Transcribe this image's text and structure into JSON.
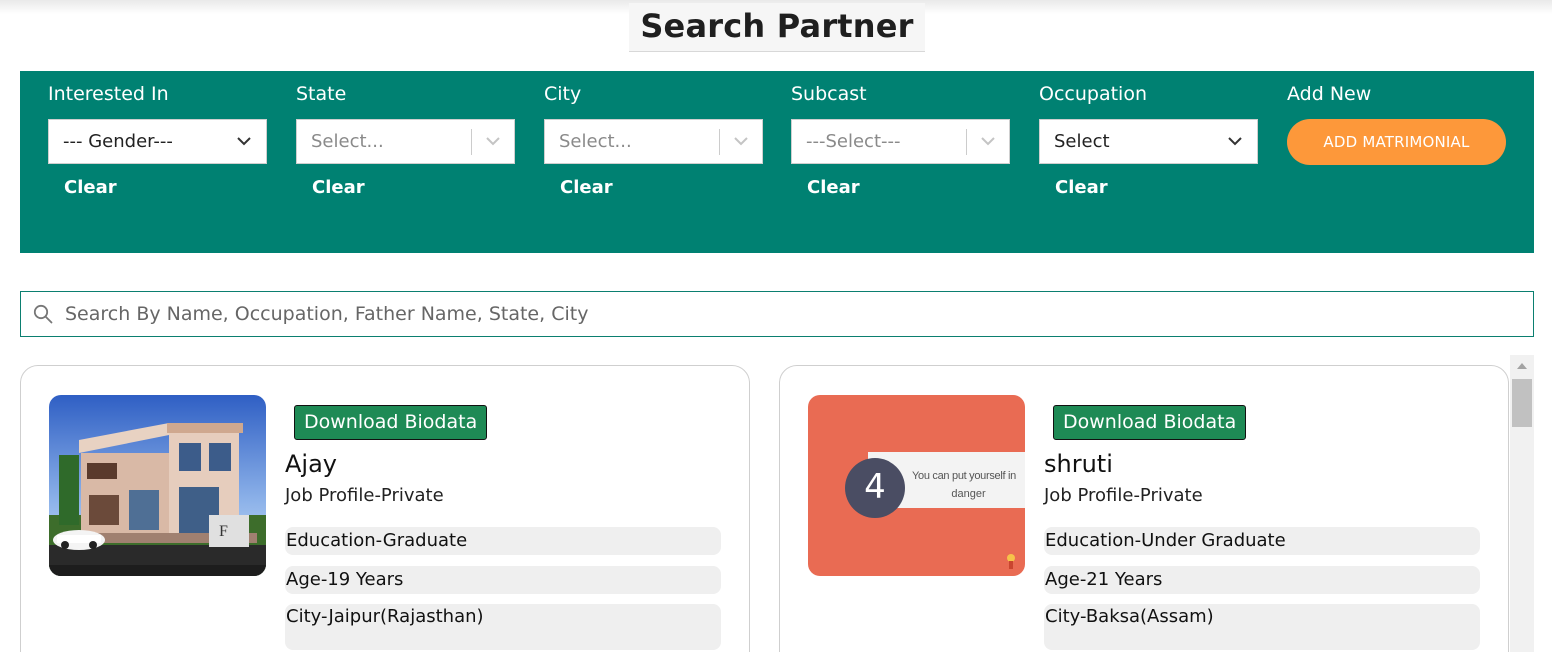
{
  "page": {
    "title": "Search Partner"
  },
  "filters": [
    {
      "label": "Interested In",
      "value": "--- Gender---",
      "placeholder": false,
      "kind": "native",
      "clear": "Clear"
    },
    {
      "label": "State",
      "value": "Select...",
      "placeholder": true,
      "kind": "react",
      "clear": "Clear"
    },
    {
      "label": "City",
      "value": "Select...",
      "placeholder": true,
      "kind": "react",
      "clear": "Clear"
    },
    {
      "label": "Subcast",
      "value": "---Select---",
      "placeholder": true,
      "kind": "react",
      "clear": "Clear"
    },
    {
      "label": "Occupation",
      "value": "Select",
      "placeholder": false,
      "kind": "native",
      "clear": "Clear"
    }
  ],
  "add_new": {
    "label": "Add New",
    "button": "ADD MATRIMONIAL"
  },
  "search": {
    "placeholder": "Search By Name, Occupation, Father Name, State, City"
  },
  "profiles": [
    {
      "download": "Download Biodata",
      "name": "Ajay",
      "job": "Job Profile-Private",
      "education": "Education-Graduate",
      "age": "Age-19 Years",
      "city": "City-Jaipur(Rajasthan)",
      "photo": "house-photo"
    },
    {
      "download": "Download Biodata",
      "name": "shruti",
      "job": "Job Profile-Private",
      "education": "Education-Under Graduate",
      "age": "Age-21 Years",
      "city": "City-Baksa(Assam)",
      "photo": "slide-photo",
      "slide": {
        "number": "4",
        "text_line1": "You can put yourself in",
        "text_line2": "danger"
      }
    }
  ],
  "colors": {
    "panel": "#008172",
    "accent": "#fd983a",
    "download": "#1e8a55"
  }
}
